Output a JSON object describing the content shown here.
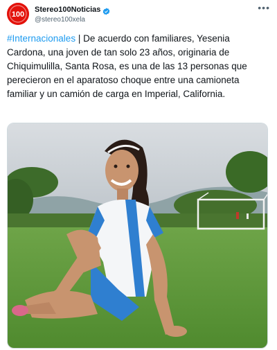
{
  "account": {
    "display_name": "Stereo100Noticias",
    "handle": "@stereo100xela",
    "avatar_text": "100",
    "verified": true
  },
  "tweet": {
    "hashtag": "#Internacionales",
    "body": " | De acuerdo con familiares, Yesenia Cardona, una joven de tan solo 23 años, originaria de Chiquimulilla, Santa Rosa, es una de las 13 personas que perecieron en el aparatoso choque entre una camioneta familiar y un camión de carga en Imperial, California."
  },
  "icons": {
    "more": "more-options-icon",
    "verified": "verified-badge-icon"
  },
  "colors": {
    "link": "#1d9bf0",
    "brand_red": "#e3120b",
    "grass": "#5d9a3a",
    "jersey_blue": "#2f7fd0"
  }
}
